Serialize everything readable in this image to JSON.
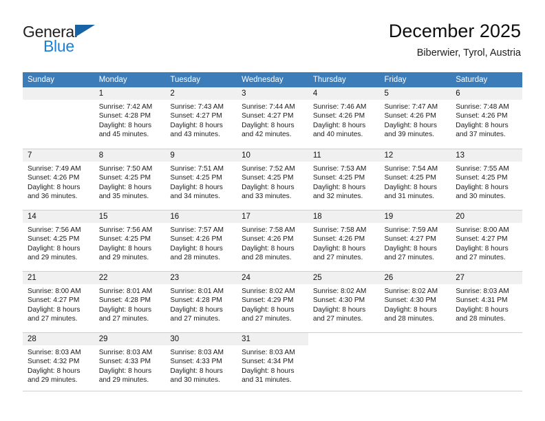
{
  "brand": {
    "name_top": "General",
    "name_bottom": "Blue",
    "triangle_icon": "triangle-icon",
    "color_dark": "#231f20",
    "color_blue": "#1b7fd4",
    "color_triangle": "#1763a6"
  },
  "header": {
    "title": "December 2025",
    "subtitle": "Biberwier, Tyrol, Austria"
  },
  "theme": {
    "header_row_bg": "#3c7cb8",
    "header_row_text": "#ffffff",
    "daynum_band_bg": "#f0f0f0",
    "cell_bg": "#ffffff",
    "divider": "#cfcfcf"
  },
  "weekday_headers": [
    "Sunday",
    "Monday",
    "Tuesday",
    "Wednesday",
    "Thursday",
    "Friday",
    "Saturday"
  ],
  "weeks": [
    [
      {
        "day": "",
        "lines": []
      },
      {
        "day": "1",
        "lines": [
          "Sunrise: 7:42 AM",
          "Sunset: 4:28 PM",
          "Daylight: 8 hours",
          "and 45 minutes."
        ]
      },
      {
        "day": "2",
        "lines": [
          "Sunrise: 7:43 AM",
          "Sunset: 4:27 PM",
          "Daylight: 8 hours",
          "and 43 minutes."
        ]
      },
      {
        "day": "3",
        "lines": [
          "Sunrise: 7:44 AM",
          "Sunset: 4:27 PM",
          "Daylight: 8 hours",
          "and 42 minutes."
        ]
      },
      {
        "day": "4",
        "lines": [
          "Sunrise: 7:46 AM",
          "Sunset: 4:26 PM",
          "Daylight: 8 hours",
          "and 40 minutes."
        ]
      },
      {
        "day": "5",
        "lines": [
          "Sunrise: 7:47 AM",
          "Sunset: 4:26 PM",
          "Daylight: 8 hours",
          "and 39 minutes."
        ]
      },
      {
        "day": "6",
        "lines": [
          "Sunrise: 7:48 AM",
          "Sunset: 4:26 PM",
          "Daylight: 8 hours",
          "and 37 minutes."
        ]
      }
    ],
    [
      {
        "day": "7",
        "lines": [
          "Sunrise: 7:49 AM",
          "Sunset: 4:26 PM",
          "Daylight: 8 hours",
          "and 36 minutes."
        ]
      },
      {
        "day": "8",
        "lines": [
          "Sunrise: 7:50 AM",
          "Sunset: 4:25 PM",
          "Daylight: 8 hours",
          "and 35 minutes."
        ]
      },
      {
        "day": "9",
        "lines": [
          "Sunrise: 7:51 AM",
          "Sunset: 4:25 PM",
          "Daylight: 8 hours",
          "and 34 minutes."
        ]
      },
      {
        "day": "10",
        "lines": [
          "Sunrise: 7:52 AM",
          "Sunset: 4:25 PM",
          "Daylight: 8 hours",
          "and 33 minutes."
        ]
      },
      {
        "day": "11",
        "lines": [
          "Sunrise: 7:53 AM",
          "Sunset: 4:25 PM",
          "Daylight: 8 hours",
          "and 32 minutes."
        ]
      },
      {
        "day": "12",
        "lines": [
          "Sunrise: 7:54 AM",
          "Sunset: 4:25 PM",
          "Daylight: 8 hours",
          "and 31 minutes."
        ]
      },
      {
        "day": "13",
        "lines": [
          "Sunrise: 7:55 AM",
          "Sunset: 4:25 PM",
          "Daylight: 8 hours",
          "and 30 minutes."
        ]
      }
    ],
    [
      {
        "day": "14",
        "lines": [
          "Sunrise: 7:56 AM",
          "Sunset: 4:25 PM",
          "Daylight: 8 hours",
          "and 29 minutes."
        ]
      },
      {
        "day": "15",
        "lines": [
          "Sunrise: 7:56 AM",
          "Sunset: 4:25 PM",
          "Daylight: 8 hours",
          "and 29 minutes."
        ]
      },
      {
        "day": "16",
        "lines": [
          "Sunrise: 7:57 AM",
          "Sunset: 4:26 PM",
          "Daylight: 8 hours",
          "and 28 minutes."
        ]
      },
      {
        "day": "17",
        "lines": [
          "Sunrise: 7:58 AM",
          "Sunset: 4:26 PM",
          "Daylight: 8 hours",
          "and 28 minutes."
        ]
      },
      {
        "day": "18",
        "lines": [
          "Sunrise: 7:58 AM",
          "Sunset: 4:26 PM",
          "Daylight: 8 hours",
          "and 27 minutes."
        ]
      },
      {
        "day": "19",
        "lines": [
          "Sunrise: 7:59 AM",
          "Sunset: 4:27 PM",
          "Daylight: 8 hours",
          "and 27 minutes."
        ]
      },
      {
        "day": "20",
        "lines": [
          "Sunrise: 8:00 AM",
          "Sunset: 4:27 PM",
          "Daylight: 8 hours",
          "and 27 minutes."
        ]
      }
    ],
    [
      {
        "day": "21",
        "lines": [
          "Sunrise: 8:00 AM",
          "Sunset: 4:27 PM",
          "Daylight: 8 hours",
          "and 27 minutes."
        ]
      },
      {
        "day": "22",
        "lines": [
          "Sunrise: 8:01 AM",
          "Sunset: 4:28 PM",
          "Daylight: 8 hours",
          "and 27 minutes."
        ]
      },
      {
        "day": "23",
        "lines": [
          "Sunrise: 8:01 AM",
          "Sunset: 4:28 PM",
          "Daylight: 8 hours",
          "and 27 minutes."
        ]
      },
      {
        "day": "24",
        "lines": [
          "Sunrise: 8:02 AM",
          "Sunset: 4:29 PM",
          "Daylight: 8 hours",
          "and 27 minutes."
        ]
      },
      {
        "day": "25",
        "lines": [
          "Sunrise: 8:02 AM",
          "Sunset: 4:30 PM",
          "Daylight: 8 hours",
          "and 27 minutes."
        ]
      },
      {
        "day": "26",
        "lines": [
          "Sunrise: 8:02 AM",
          "Sunset: 4:30 PM",
          "Daylight: 8 hours",
          "and 28 minutes."
        ]
      },
      {
        "day": "27",
        "lines": [
          "Sunrise: 8:03 AM",
          "Sunset: 4:31 PM",
          "Daylight: 8 hours",
          "and 28 minutes."
        ]
      }
    ],
    [
      {
        "day": "28",
        "lines": [
          "Sunrise: 8:03 AM",
          "Sunset: 4:32 PM",
          "Daylight: 8 hours",
          "and 29 minutes."
        ]
      },
      {
        "day": "29",
        "lines": [
          "Sunrise: 8:03 AM",
          "Sunset: 4:33 PM",
          "Daylight: 8 hours",
          "and 29 minutes."
        ]
      },
      {
        "day": "30",
        "lines": [
          "Sunrise: 8:03 AM",
          "Sunset: 4:33 PM",
          "Daylight: 8 hours",
          "and 30 minutes."
        ]
      },
      {
        "day": "31",
        "lines": [
          "Sunrise: 8:03 AM",
          "Sunset: 4:34 PM",
          "Daylight: 8 hours",
          "and 31 minutes."
        ]
      },
      {
        "day": "",
        "lines": []
      },
      {
        "day": "",
        "lines": []
      },
      {
        "day": "",
        "lines": []
      }
    ]
  ]
}
